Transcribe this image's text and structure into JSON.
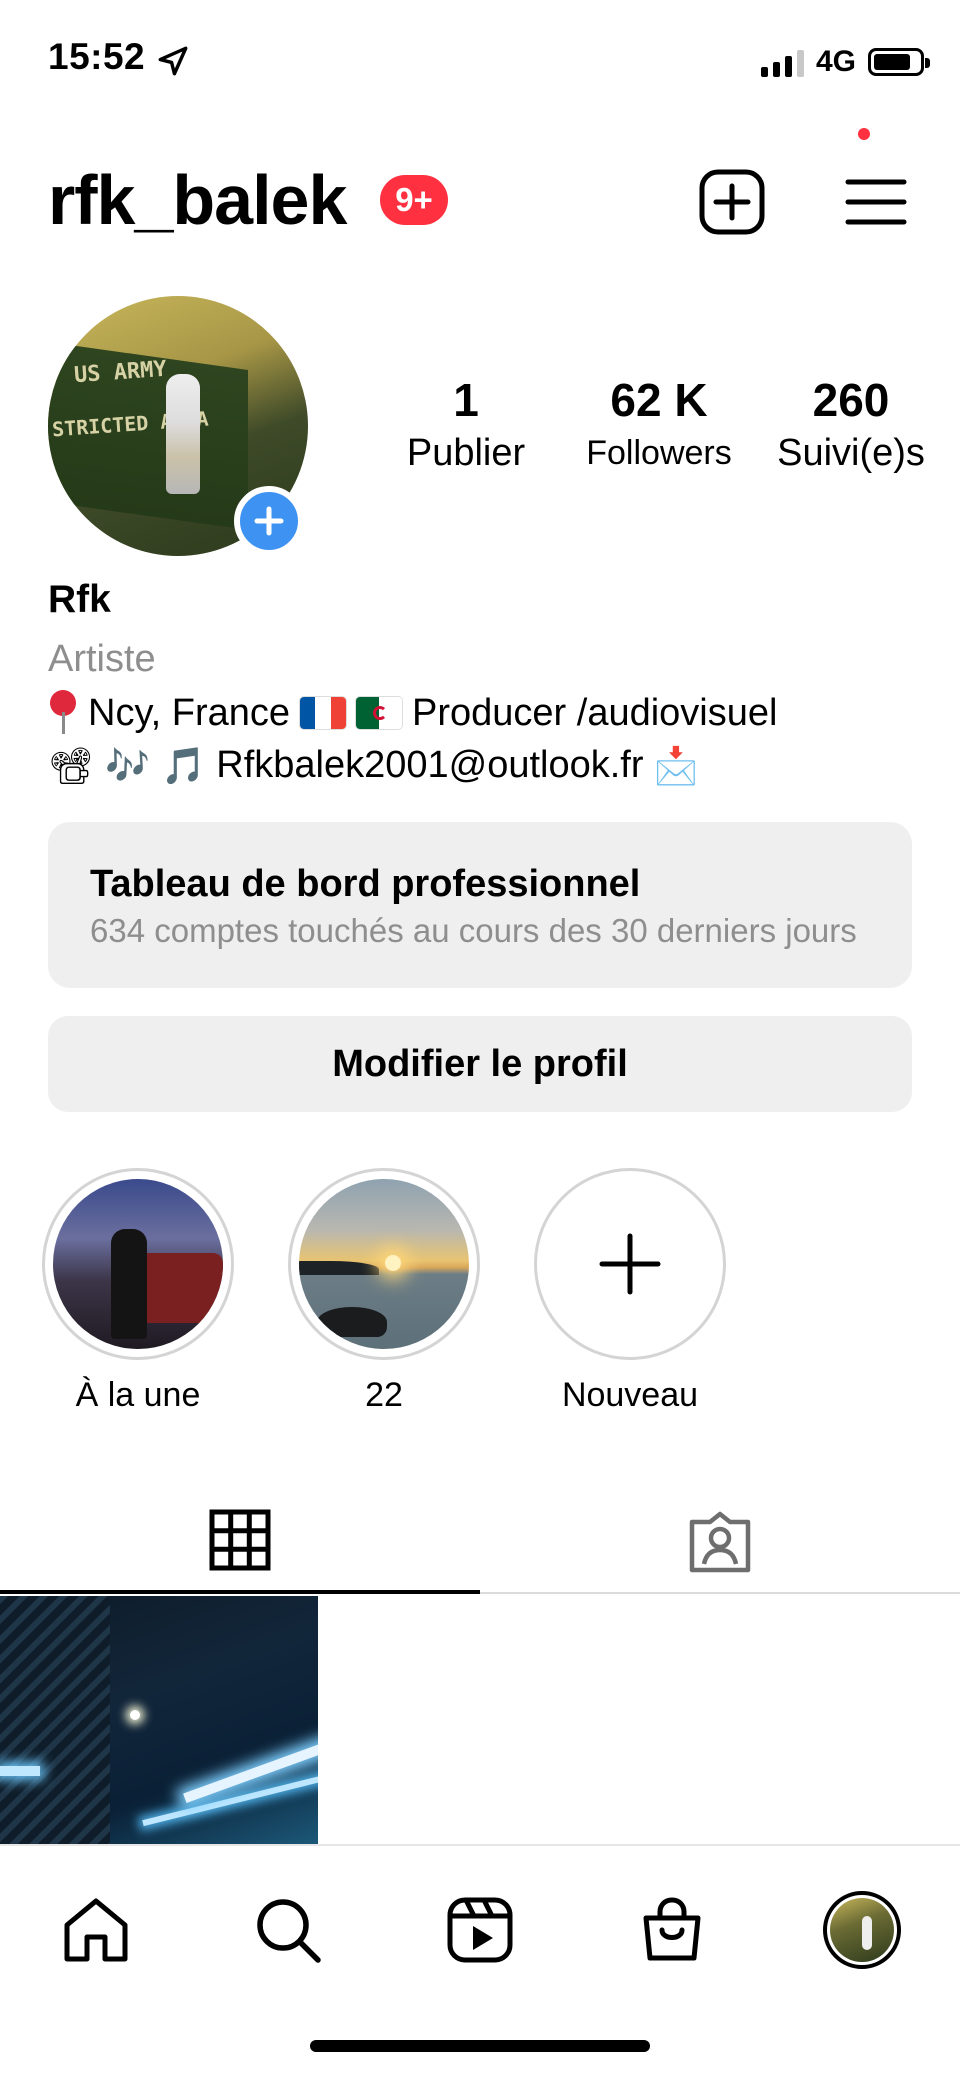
{
  "status_bar": {
    "time": "15:52",
    "network": "4G",
    "icons": [
      "location-arrow-icon",
      "signal-icon",
      "battery-icon"
    ]
  },
  "header": {
    "username": "rfk_balek",
    "notification_badge": "9+",
    "icons": [
      "new-post-icon",
      "menu-icon"
    ],
    "badge_color": "#ff3040"
  },
  "profile": {
    "stats": [
      {
        "value": "1",
        "label": "Publier"
      },
      {
        "value": "62 K",
        "label": "Followers"
      },
      {
        "value": "260",
        "label": "Suivi(e)s"
      }
    ],
    "name": "Rfk",
    "category": "Artiste",
    "bio": {
      "line1_text_a": "Ncy, France",
      "line1_text_b": "Producer /audiovisuel",
      "line2_emoji": "📽 🎶 🎵",
      "line2_email": "Rfkbalek2001@outlook.fr",
      "line2_emoji_end": "📩"
    },
    "add_story_color": "#3e93f2"
  },
  "dashboard": {
    "title": "Tableau de bord professionnel",
    "subtitle": "634 comptes touchés au cours des 30 derniers jours"
  },
  "edit_profile_label": "Modifier le profil",
  "highlights": [
    {
      "label": "À la une"
    },
    {
      "label": "22"
    },
    {
      "label": "Nouveau"
    }
  ],
  "tabs": [
    {
      "name": "posts-grid",
      "icon": "grid-icon",
      "active": true
    },
    {
      "name": "tagged",
      "icon": "tagged-person-icon",
      "active": false
    }
  ],
  "bottom_nav": {
    "items": [
      "home-icon",
      "search-icon",
      "reels-icon",
      "shop-icon",
      "profile-avatar"
    ]
  }
}
